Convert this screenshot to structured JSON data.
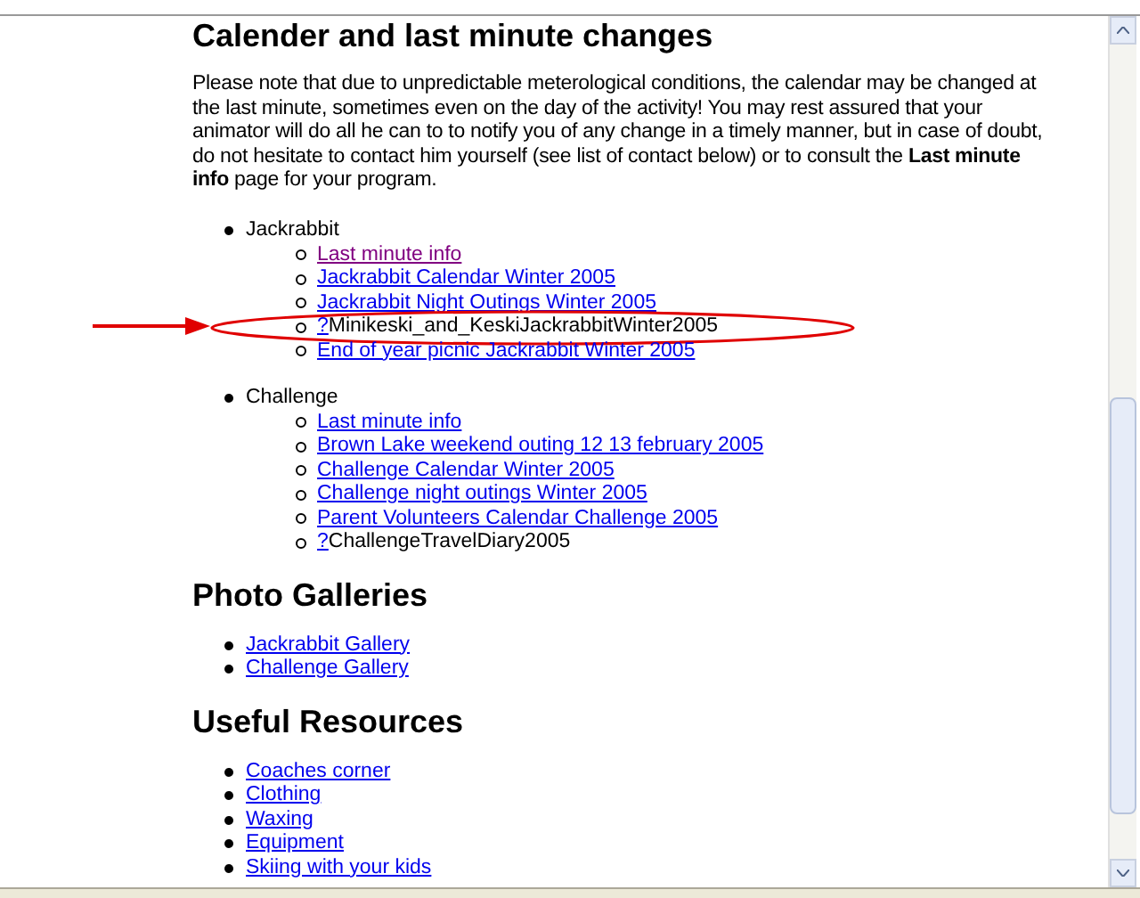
{
  "sections": [
    {
      "title": "Calender and last minute changes",
      "paragraph": "Please note that due to unpredictable meterological conditions, the calendar may be changed at the last minute, sometimes even on the day of the activity! You may rest assured that your animator will do all he can to to notify you of any change in a timely manner, but in case of doubt, do not hesitate to contact him yourself (see list of contact below) or to consult the **Last minute info** page for your program.",
      "groups": [
        {
          "label": "Jackrabbit",
          "items": [
            {
              "kind": "link",
              "text": "Last minute info",
              "visited": true,
              "highlighted": false
            },
            {
              "kind": "link",
              "text": "Jackrabbit Calendar Winter 2005",
              "visited": false,
              "highlighted": false
            },
            {
              "kind": "link",
              "text": "Jackrabbit Night Outings Winter 2005",
              "visited": false,
              "highlighted": false
            },
            {
              "kind": "missing",
              "mark": "?",
              "text": "Minikeski_and_KeskiJackrabbitWinter2005",
              "visited": false,
              "highlighted": true
            },
            {
              "kind": "link",
              "text": "End of year picnic Jackrabbit Winter 2005",
              "visited": false,
              "highlighted": false
            }
          ]
        },
        {
          "label": "Challenge",
          "items": [
            {
              "kind": "link",
              "text": "Last minute info",
              "visited": false,
              "highlighted": false
            },
            {
              "kind": "link",
              "text": "Brown Lake weekend outing 12 13 february 2005",
              "visited": false,
              "highlighted": false
            },
            {
              "kind": "link",
              "text": "Challenge Calendar Winter 2005",
              "visited": false,
              "highlighted": false
            },
            {
              "kind": "link",
              "text": "Challenge night outings Winter 2005",
              "visited": false,
              "highlighted": false
            },
            {
              "kind": "link",
              "text": "Parent Volunteers Calendar Challenge 2005",
              "visited": false,
              "highlighted": false
            },
            {
              "kind": "missing",
              "mark": "?",
              "text": "ChallengeTravelDiary2005",
              "visited": false,
              "highlighted": false
            }
          ]
        }
      ]
    },
    {
      "title": "Photo Galleries",
      "links": [
        "Jackrabbit Gallery",
        "Challenge Gallery"
      ]
    },
    {
      "title": "Useful Resources",
      "links": [
        "Coaches corner",
        "Clothing",
        "Waxing",
        "Equipment",
        "Skiing with your kids"
      ]
    }
  ]
}
